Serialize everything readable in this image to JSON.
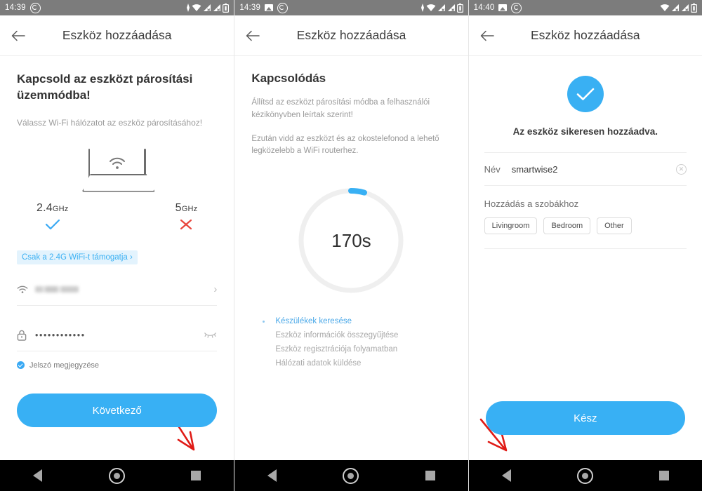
{
  "panels": [
    {
      "status": {
        "time": "14:39",
        "icons_left": [
          "whatsapp-icon"
        ],
        "icons_right": [
          "charging-bolt-icon",
          "wifi-icon",
          "signal-x-icon",
          "signal-x-icon",
          "battery-icon"
        ]
      },
      "appbar": {
        "back": "back-arrow-icon",
        "title": "Eszköz hozzáadása"
      },
      "heading": "Kapcsold az eszközt párosítási üzemmódba!",
      "subtext": "Válassz Wi-Fi hálózatot az eszköz párosításához!",
      "bands": [
        {
          "label": "2.4",
          "unit": "GHz",
          "mark": "check",
          "mark_color": "#39a9f4"
        },
        {
          "label": "5",
          "unit": "GHz",
          "mark": "cross",
          "mark_color": "#e8453c"
        }
      ],
      "chip": "Csak a 2.4G WiFi-t támogatja ›",
      "ssid_row": {
        "icon": "wifi-icon",
        "value": "",
        "chevron": "›"
      },
      "password_row": {
        "icon": "lock-icon",
        "value": "••••••••••••",
        "toggle": "eye-off-icon"
      },
      "remember": "Jelszó megjegyzése",
      "cta": "Következő"
    },
    {
      "status": {
        "time": "14:39",
        "icons_left": [
          "image-icon",
          "whatsapp-icon"
        ],
        "icons_right": [
          "charging-bolt-icon",
          "wifi-icon",
          "signal-x-icon",
          "signal-x-icon",
          "battery-icon"
        ]
      },
      "appbar": {
        "back": "back-arrow-icon",
        "title": "Eszköz hozzáadása"
      },
      "heading": "Kapcsolódás",
      "paragraphs": [
        "Állítsd az eszközt párosítási módba a felhasználói kézikönyvben leírtak szerint!",
        "Ezután vidd az eszközt és az okostelefonod a lehető legközelebb a WiFi routerhez."
      ],
      "timer": "170s",
      "progress_percent": 6,
      "steps": [
        {
          "label": "Készülékek keresése",
          "active": true
        },
        {
          "label": "Eszköz információk összegyűjtése",
          "active": false
        },
        {
          "label": "Eszköz regisztrációja folyamatban",
          "active": false
        },
        {
          "label": "Hálózati adatok küldése",
          "active": false
        }
      ]
    },
    {
      "status": {
        "time": "14:40",
        "icons_left": [
          "image-icon",
          "whatsapp-icon"
        ],
        "icons_right": [
          "wifi-icon",
          "signal-x-icon",
          "signal-x-icon",
          "battery-icon"
        ]
      },
      "appbar": {
        "back": "back-arrow-icon",
        "title": "Eszköz hozzáadása"
      },
      "success_icon": "check-circle-icon",
      "success_text": "Az eszköz sikeresen hozzáadva.",
      "name_label": "Név",
      "name_value": "smartwise2",
      "clear_icon": "clear-circle-icon",
      "rooms_label": "Hozzádás a szobákhoz",
      "rooms": [
        "Livingroom",
        "Bedroom",
        "Other"
      ],
      "cta": "Kész"
    }
  ],
  "navbar": {
    "back": "nav-back-icon",
    "home": "nav-home-icon",
    "recents": "nav-recents-icon"
  },
  "annotations": {
    "arrow_color": "#e01b16",
    "arrows": [
      "arrow-to-kovetkezo",
      "arrow-to-kesz"
    ]
  },
  "colors": {
    "accent": "#38b0f4",
    "chip_bg": "#e3f3fd",
    "status_bar": "#7c7c7c",
    "error": "#e8453c"
  }
}
